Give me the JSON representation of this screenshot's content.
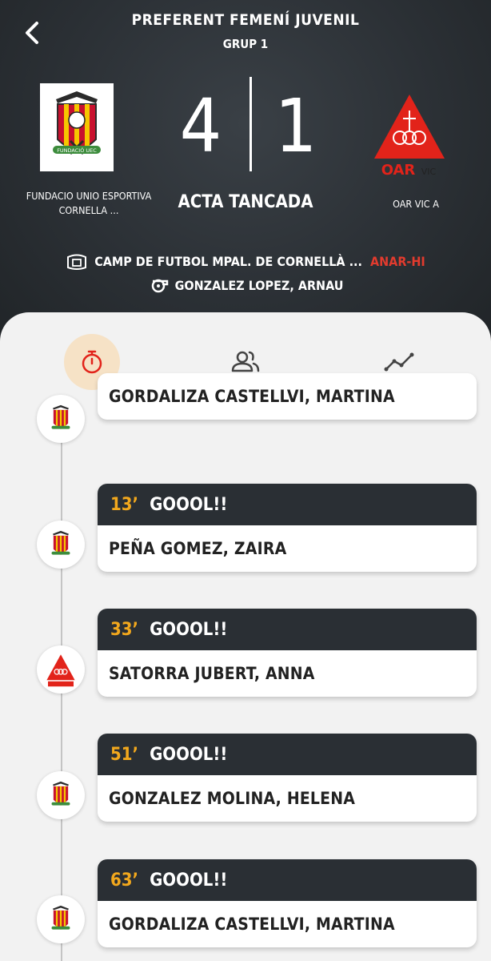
{
  "header": {
    "competition": "PREFERENT FEMENÍ JUVENIL",
    "group": "GRUP 1",
    "home_team": "FUNDACIO UNIO ESPORTIVA CORNELLA ...",
    "away_team": "OAR VIC A",
    "home_score": "4",
    "away_score": "1",
    "status": "ACTA TANCADA",
    "venue": "CAMP DE FUTBOL MPAL. DE CORNELLÀ ...",
    "venue_link": "ANAR-HI",
    "referee": "GONZALEZ LOPEZ, ARNAU",
    "home_logo_text": "FUNDACIÓ UEC",
    "away_logo_text_main": "OAR",
    "away_logo_text_sub": "VIC"
  },
  "tabs": [
    {
      "icon": "stopwatch-icon",
      "active": true
    },
    {
      "icon": "people-icon",
      "active": false
    },
    {
      "icon": "trend-icon",
      "active": false
    }
  ],
  "events": [
    {
      "minute": "",
      "label": "",
      "player": "GORDALIZA CASTELLVI, MARTINA",
      "team": "home"
    },
    {
      "minute": "13’",
      "label": "GOOOL!!",
      "player": "PEÑA GOMEZ, ZAIRA",
      "team": "home"
    },
    {
      "minute": "33’",
      "label": "GOOOL!!",
      "player": "SATORRA JUBERT, ANNA",
      "team": "away"
    },
    {
      "minute": "51’",
      "label": "GOOOL!!",
      "player": "GONZALEZ MOLINA, HELENA",
      "team": "home"
    },
    {
      "minute": "63’",
      "label": "GOOOL!!",
      "player": "GORDALIZA CASTELLVI, MARTINA",
      "team": "home"
    }
  ],
  "colors": {
    "accent": "#f2a81d",
    "link": "#e23b2e",
    "dark": "#2a2f34",
    "active_tab_bg": "#f6e2c6"
  }
}
